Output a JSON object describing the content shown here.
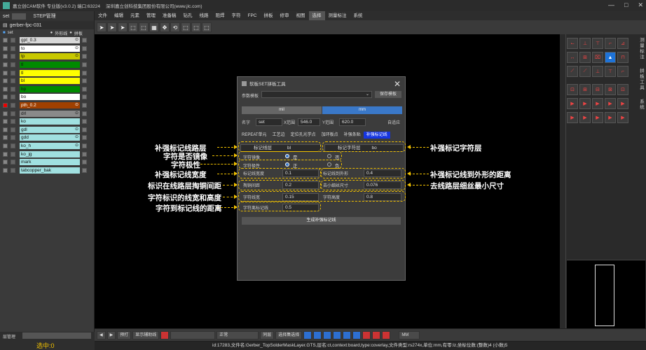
{
  "window": {
    "title": "嘉立创CAM软件 专业版(v3.0.2) 端口:63224",
    "company": "深圳嘉立创科技集团股份有限公司(www.jlc.com)",
    "controls": [
      "—",
      "□",
      "✕"
    ]
  },
  "left_panel": {
    "top_label": "set",
    "top_tab": "STEP管理",
    "project": "gerber-fpc-031",
    "col_set": "set",
    "col_outline": "外形线",
    "col_stitch": "拼板",
    "layers": [
      {
        "name": "gpt_0.3",
        "color": "#d8d8d8",
        "eye": true
      },
      {
        "name": "to",
        "color": "#ffffff",
        "eye": true
      },
      {
        "name": "tp",
        "color": "#c8c800",
        "eye": true
      },
      {
        "name": "tl",
        "color": "#008a00",
        "eye": false
      },
      {
        "name": "tl",
        "color": "#ffff00",
        "eye": false
      },
      {
        "name": "bl",
        "color": "#ffff00",
        "eye": false
      },
      {
        "name": "bp",
        "color": "#008a00",
        "eye": false
      },
      {
        "name": "bo",
        "color": "#ffffff",
        "eye": false
      },
      {
        "name": "pth_0.2",
        "color": "#a04000",
        "eye": true
      },
      {
        "name": "drl",
        "color": "#8a8a8a",
        "eye": true
      },
      {
        "name": "ko",
        "color": "#a0e0e0",
        "eye": false
      },
      {
        "name": "gdl",
        "color": "#a0e0e0",
        "eye": true
      },
      {
        "name": "gdd",
        "color": "#a0e0e0",
        "eye": true
      },
      {
        "name": "ko_h",
        "color": "#a0e0e0",
        "eye": true
      },
      {
        "name": "ko_jg",
        "color": "#a0e0e0",
        "eye": false
      },
      {
        "name": "mark",
        "color": "#a0e0e0",
        "eye": false
      },
      {
        "name": "tabcopper_bak",
        "color": "#a0e0e0",
        "eye": false
      }
    ],
    "bottom_label": "层管理",
    "selected_count": "选中:0"
  },
  "menu": [
    "文件",
    "编辑",
    "元素",
    "管理",
    "准备稿",
    "钻孔",
    "线路",
    "阻焊",
    "字符",
    "FPC",
    "拼板",
    "修审",
    "视图",
    "选择",
    "测量标注",
    "系统"
  ],
  "menu_active": "选择",
  "dialog": {
    "title": "软板SET拼板工具",
    "template_label": "参数模板",
    "save_template": "保存模板",
    "unit_mil": "mil",
    "unit_mm": "mm",
    "name_label": "名字",
    "name_value": "set",
    "x_label": "X范围",
    "x_value": "546.0",
    "y_label": "Y范围",
    "y_value": "620.0",
    "auto_fit": "自适应",
    "tabs": [
      "REPEAT单元",
      "工艺边",
      "定位孔光学点",
      "加环板点",
      "补强条贴",
      "补强标记线"
    ],
    "active_tab": "补强标记线",
    "fields": {
      "mark_layer_label": "标记线层",
      "mark_layer_value": "bl",
      "char_layer_label": "标记字符层",
      "char_layer_value": "bo",
      "mirror_label": "字符镜像",
      "mirror_yes": "是",
      "mirror_no": "否",
      "polarity_label": "字符极性",
      "polarity_pos": "正",
      "polarity_neg": "负",
      "width_label": "标记线宽度",
      "width_value": "0.1",
      "dist_outline_label": "标记线到外形",
      "dist_outline_value": "0.4",
      "gap_label": "掏铜间距",
      "gap_value": "0.2",
      "min_size_label": "去小细丝尺寸",
      "min_size_value": "0.076",
      "char_width_label": "字符线宽",
      "char_width_value": "0.15",
      "char_height_label": "字符高度",
      "char_height_value": "0.8",
      "char_dist_label": "字符离标记线",
      "char_dist_value": "0.5"
    },
    "generate": "生成补强标记线"
  },
  "annotations": {
    "mark_layer": "补强标记线路层",
    "mirror": "字符是否镜像",
    "polarity": "字符极性",
    "width": "补强标记线宽度",
    "gap": "标识在线路层掏铜间距",
    "char_size": "字符标识的线宽和高度",
    "char_dist": "字符到标记线的距离",
    "char_layer": "补强标记字符层",
    "dist_outline": "补强标记线到外形的距离",
    "min_size": "去线路层细丝最小尺寸"
  },
  "right_panel": {
    "labels": [
      "测",
      "量",
      "标",
      "注",
      "拼",
      "板",
      "工",
      "具",
      "系",
      "统"
    ]
  },
  "bottom_bar": {
    "combo1": "预打",
    "show_grid": "显示辅助线",
    "mode": "正常",
    "same_as": "同层",
    "choose": "选择集选择",
    "unit": "MM"
  },
  "status": "id:17283,文件名:Gerber_TopSolderMaskLayer.GTS,层名:ct,context:board,type:coverlay,文件类型:rs274x,单位:mm,有零:lz,坐标位数:(整数)4 (小数)5"
}
